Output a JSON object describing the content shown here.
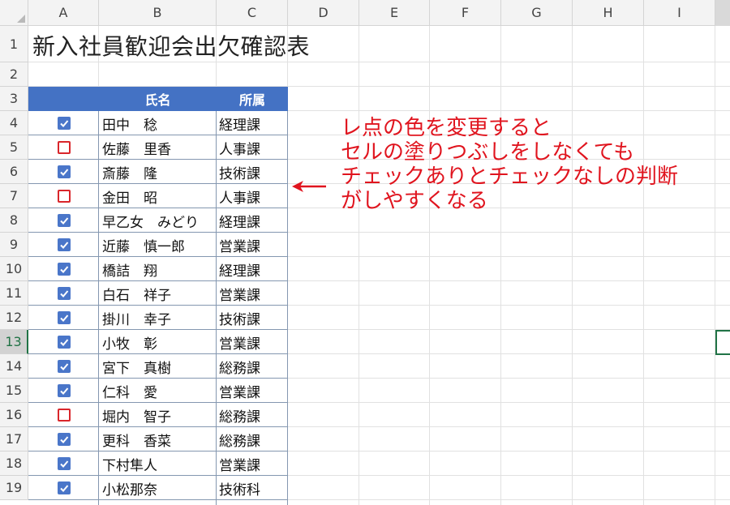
{
  "columns": [
    "A",
    "B",
    "C",
    "D",
    "E",
    "F",
    "G",
    "H",
    "I"
  ],
  "rows": [
    "1",
    "2",
    "3",
    "4",
    "5",
    "6",
    "7",
    "8",
    "9",
    "10",
    "11",
    "12",
    "13",
    "14",
    "15",
    "16",
    "17",
    "18",
    "19"
  ],
  "active_row": "13",
  "title": "新入社員歓迎会出欠確認表",
  "table": {
    "headers": [
      "",
      "氏名",
      "所属"
    ],
    "entries": [
      {
        "checked": true,
        "name": "田中　稔",
        "dept": "経理課"
      },
      {
        "checked": false,
        "name": "佐藤　里香",
        "dept": "人事課"
      },
      {
        "checked": true,
        "name": "斎藤　隆",
        "dept": "技術課"
      },
      {
        "checked": false,
        "name": "金田　昭",
        "dept": "人事課"
      },
      {
        "checked": true,
        "name": "早乙女　みどり",
        "dept": "経理課"
      },
      {
        "checked": true,
        "name": "近藤　慎一郎",
        "dept": "営業課"
      },
      {
        "checked": true,
        "name": "橋詰　翔",
        "dept": "経理課"
      },
      {
        "checked": true,
        "name": "白石　祥子",
        "dept": "営業課"
      },
      {
        "checked": true,
        "name": "掛川　幸子",
        "dept": "技術課"
      },
      {
        "checked": true,
        "name": "小牧　彰",
        "dept": "営業課"
      },
      {
        "checked": true,
        "name": "宮下　真樹",
        "dept": "総務課"
      },
      {
        "checked": true,
        "name": "仁科　愛",
        "dept": "営業課"
      },
      {
        "checked": false,
        "name": "堀内　智子",
        "dept": "総務課"
      },
      {
        "checked": true,
        "name": "更科　香菜",
        "dept": "総務課"
      },
      {
        "checked": true,
        "name": "下村隼人",
        "dept": "営業課"
      },
      {
        "checked": true,
        "name": "小松那奈",
        "dept": "技術科"
      }
    ]
  },
  "annotation": {
    "lines": [
      "レ点の色を変更すると",
      "セルの塗りつぶしをしなくても",
      "チェックありとチェックなしの判断",
      "がしやすくなる"
    ],
    "color": "#e0141e"
  },
  "colors": {
    "header_fill": "#4472c4",
    "checked_box": "#4a76c9",
    "unchecked_box": "#d9262b",
    "selection": "#217346"
  },
  "icons": {
    "checked": "checkmark-icon",
    "unchecked": "empty-box-icon",
    "arrow": "arrow-left-icon"
  }
}
